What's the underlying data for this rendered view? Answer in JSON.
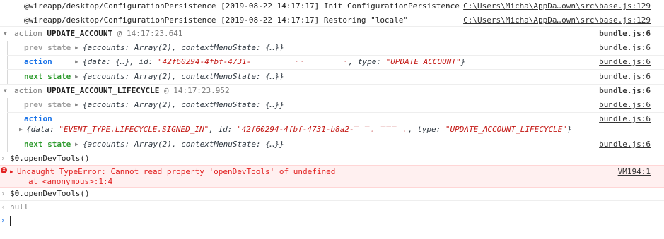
{
  "logs": [
    {
      "text": "@wireapp/desktop/ConfigurationPersistence [2019-08-22 14:17:17] Init ConfigurationPersistence",
      "source": "C:\\Users\\Micha\\AppDa…own\\src\\base.js:129"
    },
    {
      "text": "@wireapp/desktop/ConfigurationPersistence [2019-08-22 14:17:17] Restoring \"locale\"",
      "source": "C:\\Users\\Micha\\AppDa…own\\src\\base.js:129"
    }
  ],
  "group1": {
    "keyword": "action",
    "name": "UPDATE_ACCOUNT",
    "time": "@ 14:17:23.641",
    "source": "bundle.js:6",
    "prev_label": "prev state",
    "prev_value": "{accounts: Array(2), contextMenuState: {…}}",
    "prev_source": "bundle.js:6",
    "action_label": "action",
    "action_prefix": "{data: {…}, id: ",
    "action_id": "\"42f60294-4fbf-4731-",
    "action_suffix": ", type: ",
    "action_type": "\"UPDATE_ACCOUNT\"",
    "action_close": "}",
    "action_source": "bundle.js:6",
    "next_label": "next state",
    "next_value": "{accounts: Array(2), contextMenuState: {…}}",
    "next_source": "bundle.js:6"
  },
  "group2": {
    "keyword": "action",
    "name": "UPDATE_ACCOUNT_LIFECYCLE",
    "time": "@ 14:17:23.952",
    "source": "bundle.js:6",
    "prev_label": "prev state",
    "prev_value": "{accounts: Array(2), contextMenuState: {…}}",
    "prev_source": "bundle.js:6",
    "action_label": "action",
    "action_source": "bundle.js:6",
    "action_prefix": "{data: ",
    "action_data": "\"EVENT_TYPE.LIFECYCLE.SIGNED_IN\"",
    "action_mid": ", id: ",
    "action_id": "\"42f60294-4fbf-4731-b8a2-",
    "action_suffix": ", type: ",
    "action_type": "\"UPDATE_ACCOUNT_LIFECYCLE\"",
    "action_close": "}",
    "next_label": "next state",
    "next_value": "{accounts: Array(2), contextMenuState: {…}}",
    "next_source": "bundle.js:6"
  },
  "cmd1": "$0.openDevTools()",
  "error": {
    "message": "Uncaught TypeError: Cannot read property 'openDevTools' of undefined",
    "stack": "at <anonymous>:1:4",
    "source": "VM194:1"
  },
  "cmd2": "$0.openDevTools()",
  "result": "null",
  "colors": {
    "prompt": "#1a73e8",
    "error": "#e22121",
    "string": "#c41a16",
    "group_blue": "#1a73e8",
    "group_green": "#2e9b2e",
    "grey": "#9e9e9e"
  },
  "icons": [
    "prompt-chevron-icon",
    "result-chevron-icon",
    "expand-triangle-icon",
    "error-icon"
  ]
}
